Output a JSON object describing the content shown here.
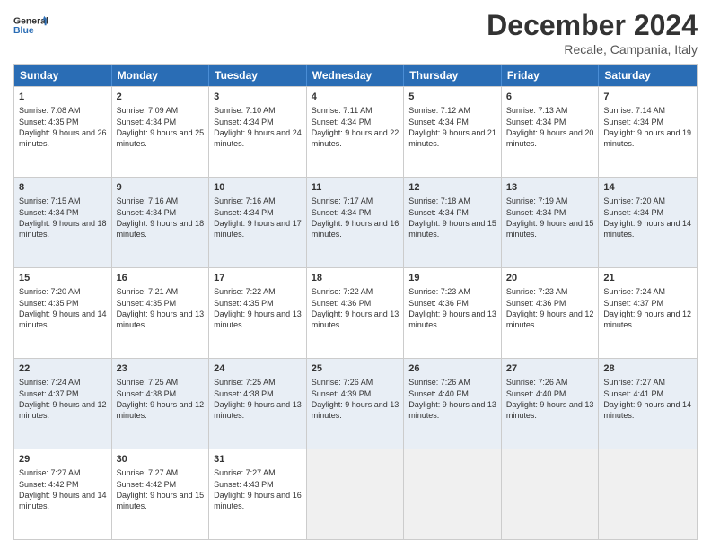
{
  "logo": {
    "line1": "General",
    "line2": "Blue"
  },
  "title": "December 2024",
  "location": "Recale, Campania, Italy",
  "days_of_week": [
    "Sunday",
    "Monday",
    "Tuesday",
    "Wednesday",
    "Thursday",
    "Friday",
    "Saturday"
  ],
  "weeks": [
    {
      "alt": false,
      "cells": [
        {
          "day": 1,
          "sunrise": "7:08 AM",
          "sunset": "4:35 PM",
          "daylight": "9 hours and 26 minutes."
        },
        {
          "day": 2,
          "sunrise": "7:09 AM",
          "sunset": "4:34 PM",
          "daylight": "9 hours and 25 minutes."
        },
        {
          "day": 3,
          "sunrise": "7:10 AM",
          "sunset": "4:34 PM",
          "daylight": "9 hours and 24 minutes."
        },
        {
          "day": 4,
          "sunrise": "7:11 AM",
          "sunset": "4:34 PM",
          "daylight": "9 hours and 22 minutes."
        },
        {
          "day": 5,
          "sunrise": "7:12 AM",
          "sunset": "4:34 PM",
          "daylight": "9 hours and 21 minutes."
        },
        {
          "day": 6,
          "sunrise": "7:13 AM",
          "sunset": "4:34 PM",
          "daylight": "9 hours and 20 minutes."
        },
        {
          "day": 7,
          "sunrise": "7:14 AM",
          "sunset": "4:34 PM",
          "daylight": "9 hours and 19 minutes."
        }
      ]
    },
    {
      "alt": true,
      "cells": [
        {
          "day": 8,
          "sunrise": "7:15 AM",
          "sunset": "4:34 PM",
          "daylight": "9 hours and 18 minutes."
        },
        {
          "day": 9,
          "sunrise": "7:16 AM",
          "sunset": "4:34 PM",
          "daylight": "9 hours and 18 minutes."
        },
        {
          "day": 10,
          "sunrise": "7:16 AM",
          "sunset": "4:34 PM",
          "daylight": "9 hours and 17 minutes."
        },
        {
          "day": 11,
          "sunrise": "7:17 AM",
          "sunset": "4:34 PM",
          "daylight": "9 hours and 16 minutes."
        },
        {
          "day": 12,
          "sunrise": "7:18 AM",
          "sunset": "4:34 PM",
          "daylight": "9 hours and 15 minutes."
        },
        {
          "day": 13,
          "sunrise": "7:19 AM",
          "sunset": "4:34 PM",
          "daylight": "9 hours and 15 minutes."
        },
        {
          "day": 14,
          "sunrise": "7:20 AM",
          "sunset": "4:34 PM",
          "daylight": "9 hours and 14 minutes."
        }
      ]
    },
    {
      "alt": false,
      "cells": [
        {
          "day": 15,
          "sunrise": "7:20 AM",
          "sunset": "4:35 PM",
          "daylight": "9 hours and 14 minutes."
        },
        {
          "day": 16,
          "sunrise": "7:21 AM",
          "sunset": "4:35 PM",
          "daylight": "9 hours and 13 minutes."
        },
        {
          "day": 17,
          "sunrise": "7:22 AM",
          "sunset": "4:35 PM",
          "daylight": "9 hours and 13 minutes."
        },
        {
          "day": 18,
          "sunrise": "7:22 AM",
          "sunset": "4:36 PM",
          "daylight": "9 hours and 13 minutes."
        },
        {
          "day": 19,
          "sunrise": "7:23 AM",
          "sunset": "4:36 PM",
          "daylight": "9 hours and 13 minutes."
        },
        {
          "day": 20,
          "sunrise": "7:23 AM",
          "sunset": "4:36 PM",
          "daylight": "9 hours and 12 minutes."
        },
        {
          "day": 21,
          "sunrise": "7:24 AM",
          "sunset": "4:37 PM",
          "daylight": "9 hours and 12 minutes."
        }
      ]
    },
    {
      "alt": true,
      "cells": [
        {
          "day": 22,
          "sunrise": "7:24 AM",
          "sunset": "4:37 PM",
          "daylight": "9 hours and 12 minutes."
        },
        {
          "day": 23,
          "sunrise": "7:25 AM",
          "sunset": "4:38 PM",
          "daylight": "9 hours and 12 minutes."
        },
        {
          "day": 24,
          "sunrise": "7:25 AM",
          "sunset": "4:38 PM",
          "daylight": "9 hours and 13 minutes."
        },
        {
          "day": 25,
          "sunrise": "7:26 AM",
          "sunset": "4:39 PM",
          "daylight": "9 hours and 13 minutes."
        },
        {
          "day": 26,
          "sunrise": "7:26 AM",
          "sunset": "4:40 PM",
          "daylight": "9 hours and 13 minutes."
        },
        {
          "day": 27,
          "sunrise": "7:26 AM",
          "sunset": "4:40 PM",
          "daylight": "9 hours and 13 minutes."
        },
        {
          "day": 28,
          "sunrise": "7:27 AM",
          "sunset": "4:41 PM",
          "daylight": "9 hours and 14 minutes."
        }
      ]
    },
    {
      "alt": false,
      "cells": [
        {
          "day": 29,
          "sunrise": "7:27 AM",
          "sunset": "4:42 PM",
          "daylight": "9 hours and 14 minutes."
        },
        {
          "day": 30,
          "sunrise": "7:27 AM",
          "sunset": "4:42 PM",
          "daylight": "9 hours and 15 minutes."
        },
        {
          "day": 31,
          "sunrise": "7:27 AM",
          "sunset": "4:43 PM",
          "daylight": "9 hours and 16 minutes."
        },
        null,
        null,
        null,
        null
      ]
    }
  ]
}
